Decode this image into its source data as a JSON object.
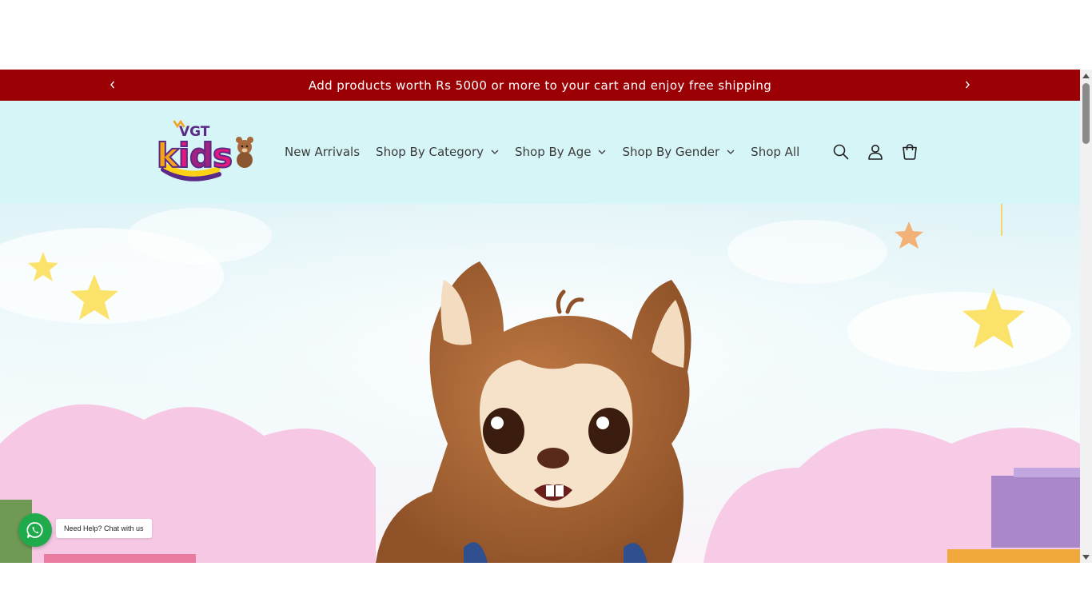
{
  "announcement": {
    "message": "Add products worth Rs 5000 or more to your cart and enjoy free shipping",
    "background": "#9a0004"
  },
  "header": {
    "logo": {
      "text_top": "VGT",
      "text_main": "kids"
    },
    "nav": [
      {
        "label": "New Arrivals",
        "has_dropdown": false
      },
      {
        "label": "Shop By Category",
        "has_dropdown": true
      },
      {
        "label": "Shop By Age",
        "has_dropdown": true
      },
      {
        "label": "Shop By Gender",
        "has_dropdown": true
      },
      {
        "label": "Shop All",
        "has_dropdown": false
      }
    ],
    "icons": [
      "search-icon",
      "account-icon",
      "cart-icon"
    ],
    "background": "#d6f5f7"
  },
  "hero": {
    "image": "plush squirrel toy waving in a pastel nursery scene with stars and clouds"
  },
  "chat_widget": {
    "label": "Need Help? Chat with us",
    "color": "#1fab4b"
  }
}
